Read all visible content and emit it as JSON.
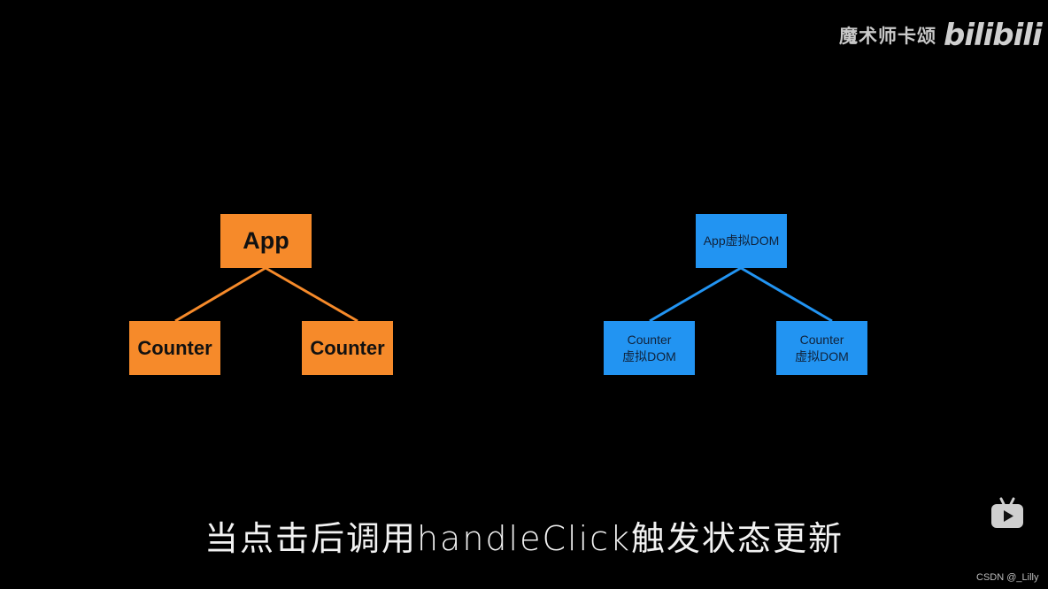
{
  "watermark": {
    "author": "魔术师卡颂",
    "logo": "bilibili"
  },
  "diagrams": {
    "component_tree": {
      "color": "#f68a2a",
      "root": "App",
      "children": [
        "Counter",
        "Counter"
      ]
    },
    "virtual_dom_tree": {
      "color": "#2294f2",
      "root": "App虚拟DOM",
      "children": [
        {
          "line1": "Counter",
          "line2": "虚拟DOM"
        },
        {
          "line1": "Counter",
          "line2": "虚拟DOM"
        }
      ]
    }
  },
  "subtitle": "当点击后调用handleClick触发状态更新",
  "icons": {
    "player": "bilibili-tv-play-icon"
  },
  "credit": "CSDN @_Lilly"
}
